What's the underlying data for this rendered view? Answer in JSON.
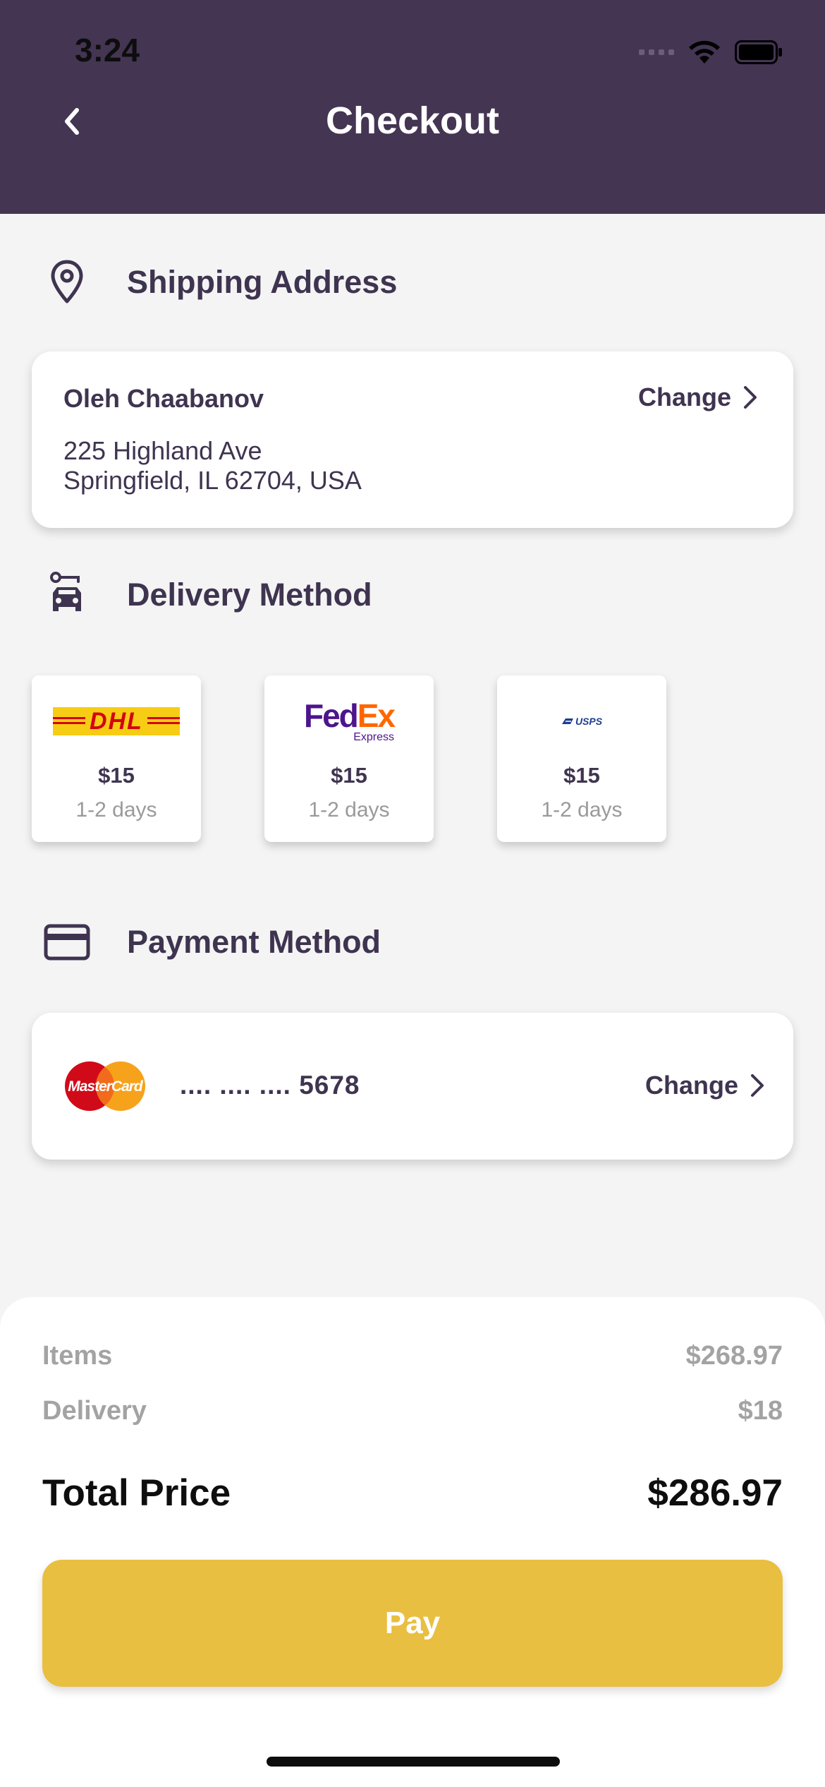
{
  "status_bar": {
    "time": "3:24"
  },
  "header": {
    "title": "Checkout"
  },
  "shipping": {
    "heading": "Shipping Address",
    "name": "Oleh Chaabanov",
    "change_label": "Change",
    "line1": "225 Highland Ave",
    "line2": "Springfield, IL 62704, USA"
  },
  "delivery": {
    "heading": "Delivery Method",
    "options": [
      {
        "carrier": "DHL",
        "logo_text": "DHL",
        "price": "$15",
        "days": "1-2 days"
      },
      {
        "carrier": "FedEx",
        "logo_text": "FedEx",
        "logo_subtext": "Express",
        "price": "$15",
        "days": "1-2 days"
      },
      {
        "carrier": "USPS",
        "logo_text": "USPS",
        "price": "$15",
        "days": "1-2 days"
      }
    ]
  },
  "payment": {
    "heading": "Payment Method",
    "card_brand": "MasterCard",
    "card_number": ".... .... .... 5678",
    "change_label": "Change"
  },
  "summary": {
    "items_label": "Items",
    "items_value": "$268.97",
    "delivery_label": "Delivery",
    "delivery_value": "$18",
    "total_label": "Total Price",
    "total_value": "$286.97",
    "pay_label": "Pay"
  },
  "colors": {
    "header_bg": "#443553",
    "text_primary": "#3f3450",
    "accent": "#e9bf41"
  }
}
